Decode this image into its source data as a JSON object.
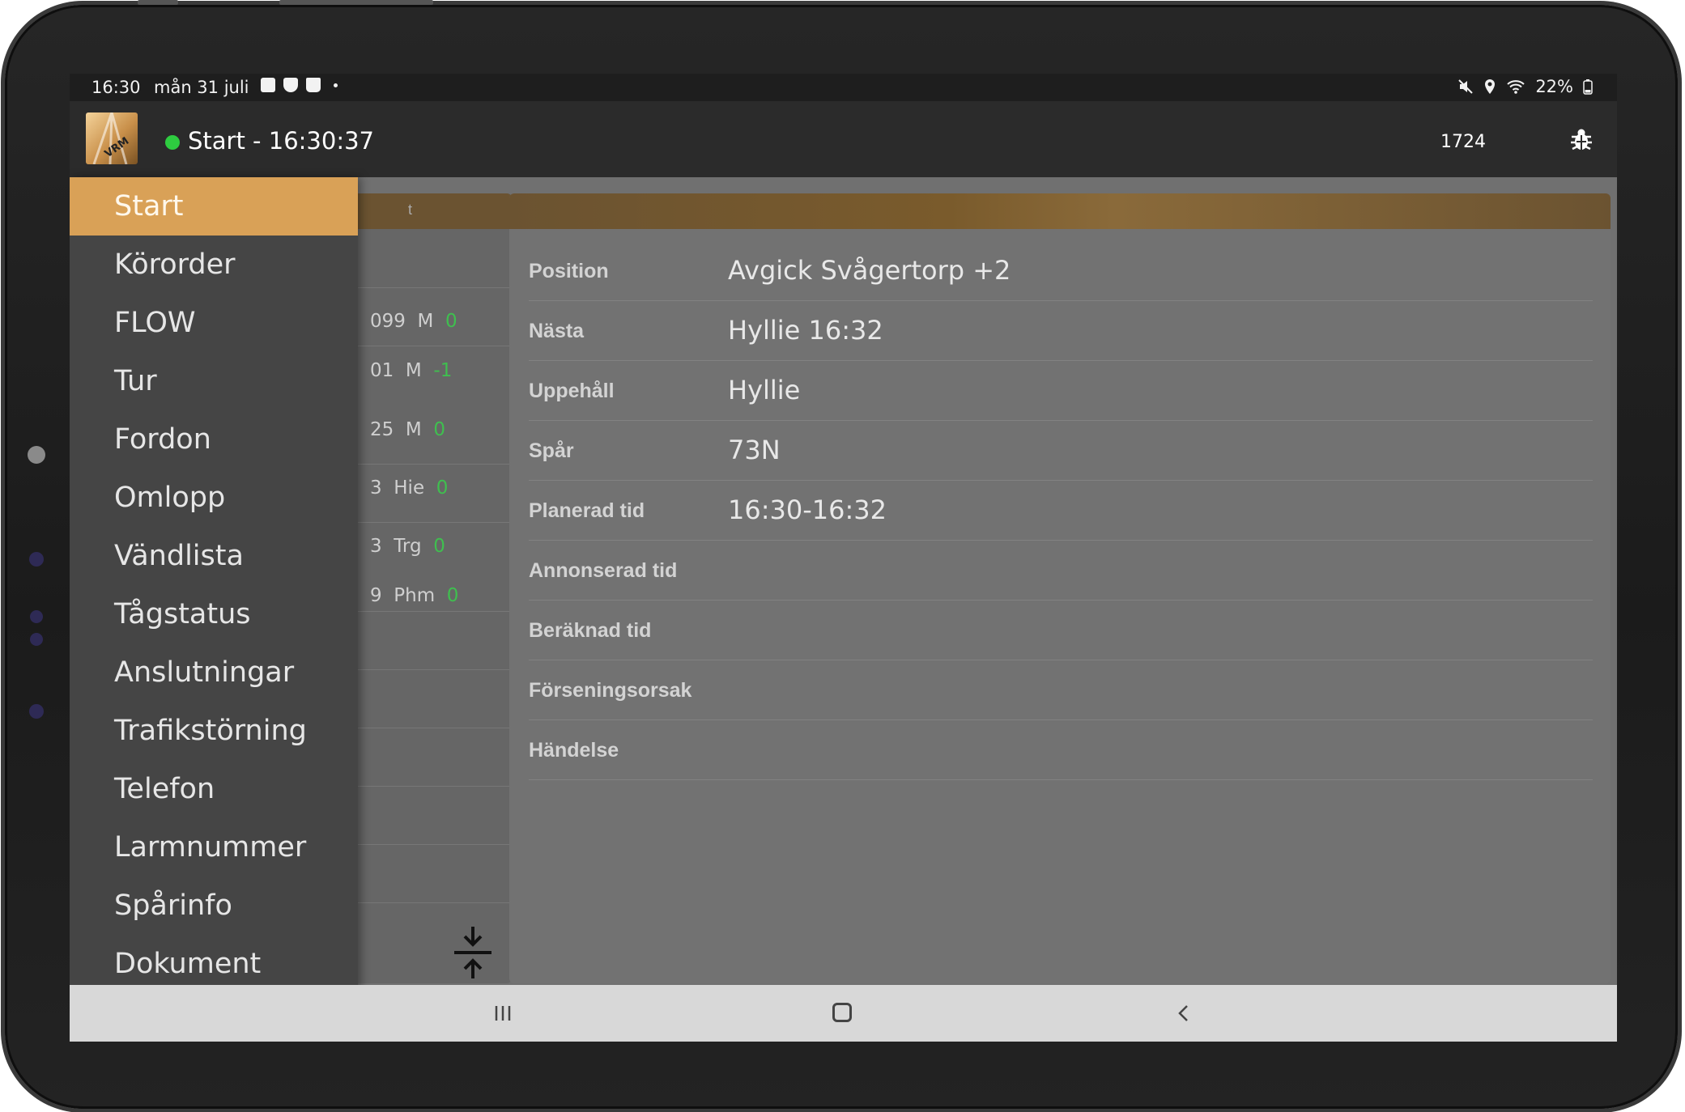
{
  "status_bar": {
    "time": "16:30",
    "date": "mån 31 juli",
    "battery": "22%"
  },
  "app_bar": {
    "title": "Start - 16:30:37",
    "status_color": "#2ecc40",
    "train_number": "1724",
    "logo_text": "VRM",
    "icons": [
      "moon-icon",
      "bug-icon"
    ]
  },
  "drawer": {
    "items": [
      {
        "label": "Start",
        "active": true
      },
      {
        "label": "Körorder",
        "active": false
      },
      {
        "label": "FLOW",
        "active": false
      },
      {
        "label": "Tur",
        "active": false
      },
      {
        "label": "Fordon",
        "active": false
      },
      {
        "label": "Omlopp",
        "active": false
      },
      {
        "label": "Vändlista",
        "active": false
      },
      {
        "label": "Tågstatus",
        "active": false
      },
      {
        "label": "Anslutningar",
        "active": false
      },
      {
        "label": "Trafikstörning",
        "active": false
      },
      {
        "label": "Telefon",
        "active": false
      },
      {
        "label": "Larmnummer",
        "active": false
      },
      {
        "label": "Spårinfo",
        "active": false
      },
      {
        "label": "Dokument",
        "active": false
      }
    ],
    "accent_color": "#d9a157"
  },
  "stops_list": {
    "header_fragment": "t",
    "rows": [
      {
        "code": "099",
        "suffix": "M",
        "delay": "0"
      },
      {
        "code": "01",
        "suffix": "M",
        "delay": "-1"
      },
      {
        "code": "25",
        "suffix": "M",
        "delay": "0"
      },
      {
        "code": "3",
        "suffix": "Hie",
        "delay": "0"
      },
      {
        "code": "3",
        "suffix": "Trg",
        "delay": "0"
      },
      {
        "code": "9",
        "suffix": "Phm",
        "delay": "0"
      }
    ]
  },
  "details": {
    "rows": [
      {
        "label": "Position",
        "value": "Avgick Svågertorp +2"
      },
      {
        "label": "Nästa",
        "value": "Hyllie 16:32"
      },
      {
        "label": "Uppehåll",
        "value": "Hyllie"
      },
      {
        "label": "Spår",
        "value": "73N"
      },
      {
        "label": "Planerad tid",
        "value": "16:30-16:32"
      },
      {
        "label": "Annonserad tid",
        "value": ""
      },
      {
        "label": "Beräknad tid",
        "value": ""
      },
      {
        "label": "Förseningsorsak",
        "value": ""
      },
      {
        "label": "Händelse",
        "value": ""
      }
    ]
  }
}
